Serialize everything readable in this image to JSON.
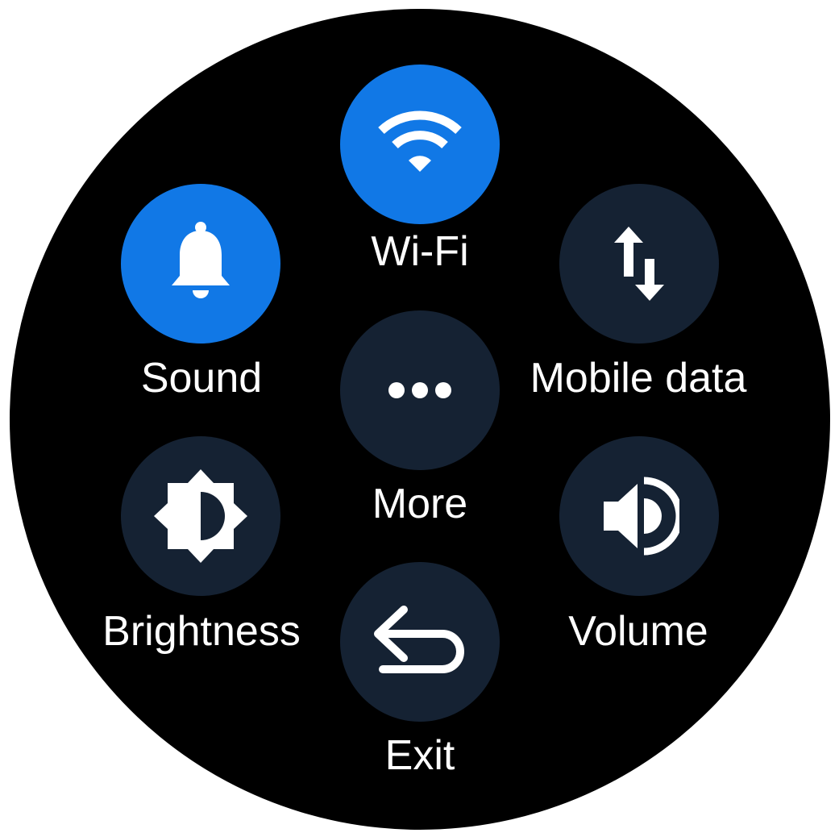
{
  "colors": {
    "active": "#1178e6",
    "inactive": "#152233",
    "background": "#000000",
    "foreground": "#ffffff"
  },
  "tiles": {
    "wifi": {
      "label": "Wi-Fi",
      "icon": "wifi-icon",
      "state": "on"
    },
    "sound": {
      "label": "Sound",
      "icon": "bell-icon",
      "state": "on"
    },
    "mobile_data": {
      "label": "Mobile data",
      "icon": "up-down-arrows-icon",
      "state": "off"
    },
    "more": {
      "label": "More",
      "icon": "more-dots-icon",
      "state": "off"
    },
    "brightness": {
      "label": "Brightness",
      "icon": "brightness-icon",
      "state": "off"
    },
    "volume": {
      "label": "Volume",
      "icon": "speaker-icon",
      "state": "off"
    },
    "exit": {
      "label": "Exit",
      "icon": "back-arrow-icon",
      "state": "off"
    }
  }
}
